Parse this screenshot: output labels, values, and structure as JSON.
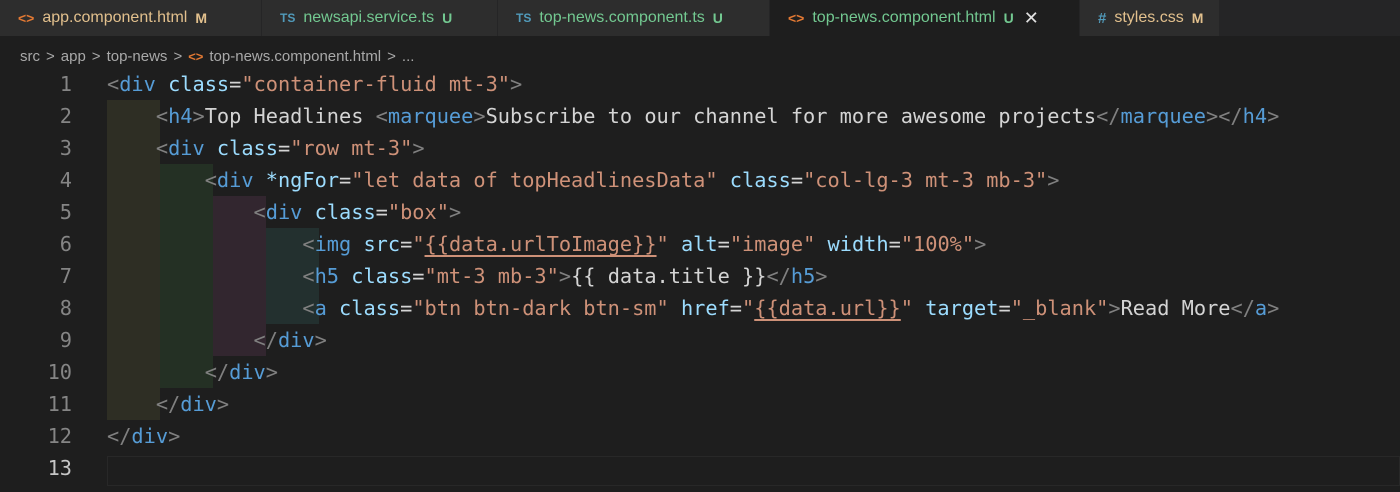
{
  "tabs": [
    {
      "icon": "<>",
      "icon_kind": "html",
      "name": "app.component.html",
      "status": "M",
      "status_color": "#e2c08d",
      "name_color": "#e2c08d",
      "active": false
    },
    {
      "icon": "TS",
      "icon_kind": "ts",
      "name": "newsapi.service.ts",
      "status": "U",
      "status_color": "#73c991",
      "name_color": "#73c991",
      "active": false
    },
    {
      "icon": "TS",
      "icon_kind": "ts",
      "name": "top-news.component.ts",
      "status": "U",
      "status_color": "#73c991",
      "name_color": "#73c991",
      "active": false
    },
    {
      "icon": "<>",
      "icon_kind": "html",
      "name": "top-news.component.html",
      "status": "U",
      "status_color": "#73c991",
      "name_color": "#73c991",
      "active": true,
      "close": "✕"
    },
    {
      "icon": "#",
      "icon_kind": "css",
      "name": "styles.css",
      "status": "M",
      "status_color": "#e2c08d",
      "name_color": "#e2c08d",
      "active": false
    }
  ],
  "breadcrumb": {
    "parts": [
      "src",
      "app",
      "top-news"
    ],
    "separator": ">",
    "file_icon": "<>",
    "file": "top-news.component.html",
    "more": "..."
  },
  "editor": {
    "active_line": 13,
    "lines": [
      {
        "n": "1",
        "indent": "",
        "tokens": [
          [
            "tg",
            "<"
          ],
          [
            "tn",
            "div"
          ],
          [
            "tx",
            " "
          ],
          [
            "at",
            "class"
          ],
          [
            "tx",
            "="
          ],
          [
            "st",
            "\"container-fluid mt-3\""
          ],
          [
            "tg",
            ">"
          ]
        ]
      },
      {
        "n": "2",
        "indent": "    ",
        "tokens": [
          [
            "tg",
            "<"
          ],
          [
            "tn",
            "h4"
          ],
          [
            "tg",
            ">"
          ],
          [
            "tx",
            "Top Headlines "
          ],
          [
            "tg",
            "<"
          ],
          [
            "tn",
            "marquee"
          ],
          [
            "tg",
            ">"
          ],
          [
            "tx",
            "Subscribe to our channel for more awesome projects"
          ],
          [
            "tg",
            "</"
          ],
          [
            "tn",
            "marquee"
          ],
          [
            "tg",
            "></"
          ],
          [
            "tn",
            "h4"
          ],
          [
            "tg",
            ">"
          ]
        ]
      },
      {
        "n": "3",
        "indent": "    ",
        "tokens": [
          [
            "tg",
            "<"
          ],
          [
            "tn",
            "div"
          ],
          [
            "tx",
            " "
          ],
          [
            "at",
            "class"
          ],
          [
            "tx",
            "="
          ],
          [
            "st",
            "\"row mt-3\""
          ],
          [
            "tg",
            ">"
          ]
        ]
      },
      {
        "n": "4",
        "indent": "        ",
        "tokens": [
          [
            "tg",
            "<"
          ],
          [
            "tn",
            "div"
          ],
          [
            "tx",
            " "
          ],
          [
            "at",
            "*ngFor"
          ],
          [
            "tx",
            "="
          ],
          [
            "st",
            "\"let data of topHeadlinesData\""
          ],
          [
            "tx",
            " "
          ],
          [
            "at",
            "class"
          ],
          [
            "tx",
            "="
          ],
          [
            "st",
            "\"col-lg-3 mt-3 mb-3\""
          ],
          [
            "tg",
            ">"
          ]
        ]
      },
      {
        "n": "5",
        "indent": "            ",
        "tokens": [
          [
            "tg",
            "<"
          ],
          [
            "tn",
            "div"
          ],
          [
            "tx",
            " "
          ],
          [
            "at",
            "class"
          ],
          [
            "tx",
            "="
          ],
          [
            "st",
            "\"box\""
          ],
          [
            "tg",
            ">"
          ]
        ]
      },
      {
        "n": "6",
        "indent": "                ",
        "tokens": [
          [
            "tg",
            "<"
          ],
          [
            "tn",
            "img"
          ],
          [
            "tx",
            " "
          ],
          [
            "at",
            "src"
          ],
          [
            "tx",
            "="
          ],
          [
            "st",
            "\""
          ],
          [
            "st ul",
            "{{data.urlToImage}}"
          ],
          [
            "st",
            "\""
          ],
          [
            "tx",
            " "
          ],
          [
            "at",
            "alt"
          ],
          [
            "tx",
            "="
          ],
          [
            "st",
            "\"image\""
          ],
          [
            "tx",
            " "
          ],
          [
            "at",
            "width"
          ],
          [
            "tx",
            "="
          ],
          [
            "st",
            "\"100%\""
          ],
          [
            "tg",
            ">"
          ]
        ]
      },
      {
        "n": "7",
        "indent": "                ",
        "tokens": [
          [
            "tg",
            "<"
          ],
          [
            "tn",
            "h5"
          ],
          [
            "tx",
            " "
          ],
          [
            "at",
            "class"
          ],
          [
            "tx",
            "="
          ],
          [
            "st",
            "\"mt-3 mb-3\""
          ],
          [
            "tg",
            ">"
          ],
          [
            "tx",
            "{{ data.title }}"
          ],
          [
            "tg",
            "</"
          ],
          [
            "tn",
            "h5"
          ],
          [
            "tg",
            ">"
          ]
        ]
      },
      {
        "n": "8",
        "indent": "                ",
        "tokens": [
          [
            "tg",
            "<"
          ],
          [
            "tn",
            "a"
          ],
          [
            "tx",
            " "
          ],
          [
            "at",
            "class"
          ],
          [
            "tx",
            "="
          ],
          [
            "st",
            "\"btn btn-dark btn-sm\""
          ],
          [
            "tx",
            " "
          ],
          [
            "at",
            "href"
          ],
          [
            "tx",
            "="
          ],
          [
            "st",
            "\""
          ],
          [
            "st ul",
            "{{data.url}}"
          ],
          [
            "st",
            "\""
          ],
          [
            "tx",
            " "
          ],
          [
            "at",
            "target"
          ],
          [
            "tx",
            "="
          ],
          [
            "st",
            "\"_blank\""
          ],
          [
            "tg",
            ">"
          ],
          [
            "tx",
            "Read More"
          ],
          [
            "tg",
            "</"
          ],
          [
            "tn",
            "a"
          ],
          [
            "tg",
            ">"
          ]
        ]
      },
      {
        "n": "9",
        "indent": "            ",
        "tokens": [
          [
            "tg",
            "</"
          ],
          [
            "tn",
            "div"
          ],
          [
            "tg",
            ">"
          ]
        ]
      },
      {
        "n": "10",
        "indent": "        ",
        "tokens": [
          [
            "tg",
            "</"
          ],
          [
            "tn",
            "div"
          ],
          [
            "tg",
            ">"
          ]
        ]
      },
      {
        "n": "11",
        "indent": "    ",
        "tokens": [
          [
            "tg",
            "</"
          ],
          [
            "tn",
            "div"
          ],
          [
            "tg",
            ">"
          ]
        ]
      },
      {
        "n": "12",
        "indent": "",
        "tokens": [
          [
            "tg",
            "</"
          ],
          [
            "tn",
            "div"
          ],
          [
            "tg",
            ">"
          ]
        ]
      },
      {
        "n": "13",
        "indent": "",
        "tokens": []
      }
    ]
  }
}
